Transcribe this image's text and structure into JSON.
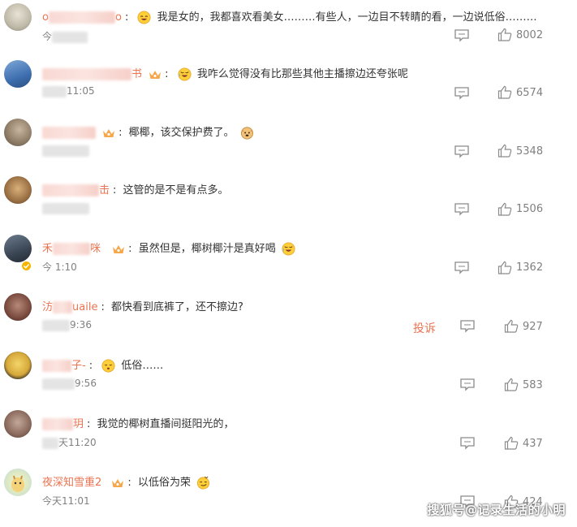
{
  "comments": [
    {
      "name_visible_start": "o",
      "name_visible_end": "o",
      "text": "我是女的，我都喜欢看美女………有些人，一边目不转睛的看，一边说低俗………",
      "time_visible": "今",
      "likes": "8002"
    },
    {
      "name_visible_end": "书",
      "text": "我咋么觉得没有比那些其他主播擦边还夸张呢",
      "time_visible": "11:05",
      "likes": "6574"
    },
    {
      "text": "椰椰，该交保护费了。",
      "likes": "5348"
    },
    {
      "name_visible_end": "击",
      "text": "这管的是不是有点多。",
      "likes": "1506"
    },
    {
      "name_visible_start": "禾",
      "name_visible_end": "咪",
      "text": "虽然但是，椰树椰汁是真好喝",
      "time_visible": "今   1:10",
      "likes": "1362"
    },
    {
      "name_visible_start": "汸",
      "name_visible_end": "uaile",
      "text": "都快看到底裤了，还不擦边?",
      "time_visible": "9:36",
      "report": "投诉",
      "likes": "927"
    },
    {
      "name_visible_end": "子-",
      "text": "低俗……",
      "time_visible": "9:56",
      "likes": "583"
    },
    {
      "name_visible_end": "玥",
      "text": "我觉的椰树直播间挺阳光的，",
      "time_visible": "天11:20",
      "likes": "437"
    },
    {
      "name": "夜深知雪重2",
      "text": "以低俗为荣",
      "time": "今天11:01",
      "likes": "424"
    }
  ],
  "watermark": "搜狐号@记录生活的小明",
  "colors": {
    "username": "#eb7350",
    "meta": "#808080",
    "text": "#333333"
  }
}
